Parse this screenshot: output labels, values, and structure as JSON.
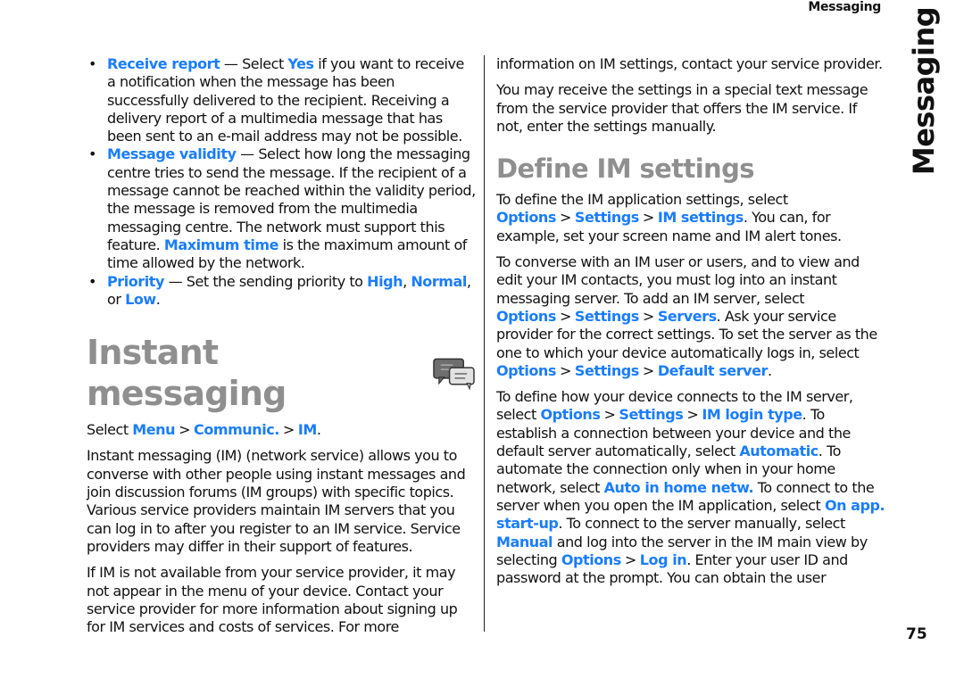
{
  "header": {
    "running_head": "Messaging",
    "thumb_tab": "Messaging"
  },
  "left": {
    "bullets": [
      {
        "term": "Receive report",
        "pre": " — Select ",
        "opt": "Yes",
        "post": " if you want to receive a notification when the message has been successfully delivered to the recipient. Receiving a delivery report of a multimedia message that has been sent to an e-mail address may not be possible."
      },
      {
        "term": "Message validity",
        "pre": " — Select how long the messaging centre tries to send the message. If the recipient of a message cannot be reached within the validity period, the message is removed from the multimedia messaging centre. The network must support this feature. ",
        "opt": "Maximum time",
        "post": " is the maximum amount of time allowed by the network."
      },
      {
        "term": "Priority",
        "pre": " — Set the sending priority to ",
        "opt": "High",
        "mid": ", ",
        "opt2": "Normal",
        "mid2": ", or ",
        "opt3": "Low",
        "post": "."
      }
    ],
    "heading": "Instant messaging",
    "heading_icon": "chat-bubbles-icon",
    "path": {
      "pre": "Select ",
      "items": [
        "Menu",
        "Communic.",
        "IM"
      ],
      "post": "."
    },
    "para1": "Instant messaging (IM) (network service) allows you to converse with other people using instant messages and join discussion forums (IM groups) with specific topics. Various service providers maintain IM servers that you can log in to after you register to an IM service. Service providers may differ in their support of features.",
    "para2": "If IM is not available from your service provider, it may not appear in the menu of your device. Contact your service provider for more information about signing up for IM services and costs of services. For more"
  },
  "right": {
    "para1": "information on IM settings, contact your service provider.",
    "para2": "You may receive the settings in a special text message from the service provider that offers the IM service. If not, enter the settings manually.",
    "heading": "Define IM settings",
    "p3": {
      "a": "To define the IM application settings, select ",
      "k1": "Options",
      "k2": "Settings",
      "k3": "IM settings",
      "b": ". You can, for example, set your screen name and IM alert tones."
    },
    "p4": {
      "a": "To converse with an IM user or users, and to view and edit your IM contacts, you must log into an instant messaging server. To add an IM server, select ",
      "k1": "Options",
      "k2": "Settings",
      "k3": "Servers",
      "b": ". Ask your service provider for the correct settings. To set the server as the one to which your device automatically logs in, select ",
      "k4": "Options",
      "k5": "Settings",
      "k6": "Default server",
      "c": "."
    },
    "p5": {
      "a": "To define how your device connects to the IM server, select ",
      "k1": "Options",
      "k2": "Settings",
      "k3": "IM login type",
      "b": ". To establish a connection between your device and the default server automatically, select ",
      "k4": "Automatic",
      "c": ". To automate the connection only when in your home network, select ",
      "k5": "Auto in home netw.",
      "d": " To connect to the server when you open the IM application, select ",
      "k6": "On app. start-up",
      "e": ". To connect to the server manually, select ",
      "k7": "Manual",
      "f": " and log into the server in the IM main view by selecting ",
      "k8": "Options",
      "k9": "Log in",
      "g": ". Enter your user ID and password at the prompt. You can obtain the user"
    }
  },
  "separator": ">",
  "page_number": "75",
  "colors": {
    "link": "#1a7dff",
    "heading": "#8f8f8f",
    "text": "#111111"
  }
}
